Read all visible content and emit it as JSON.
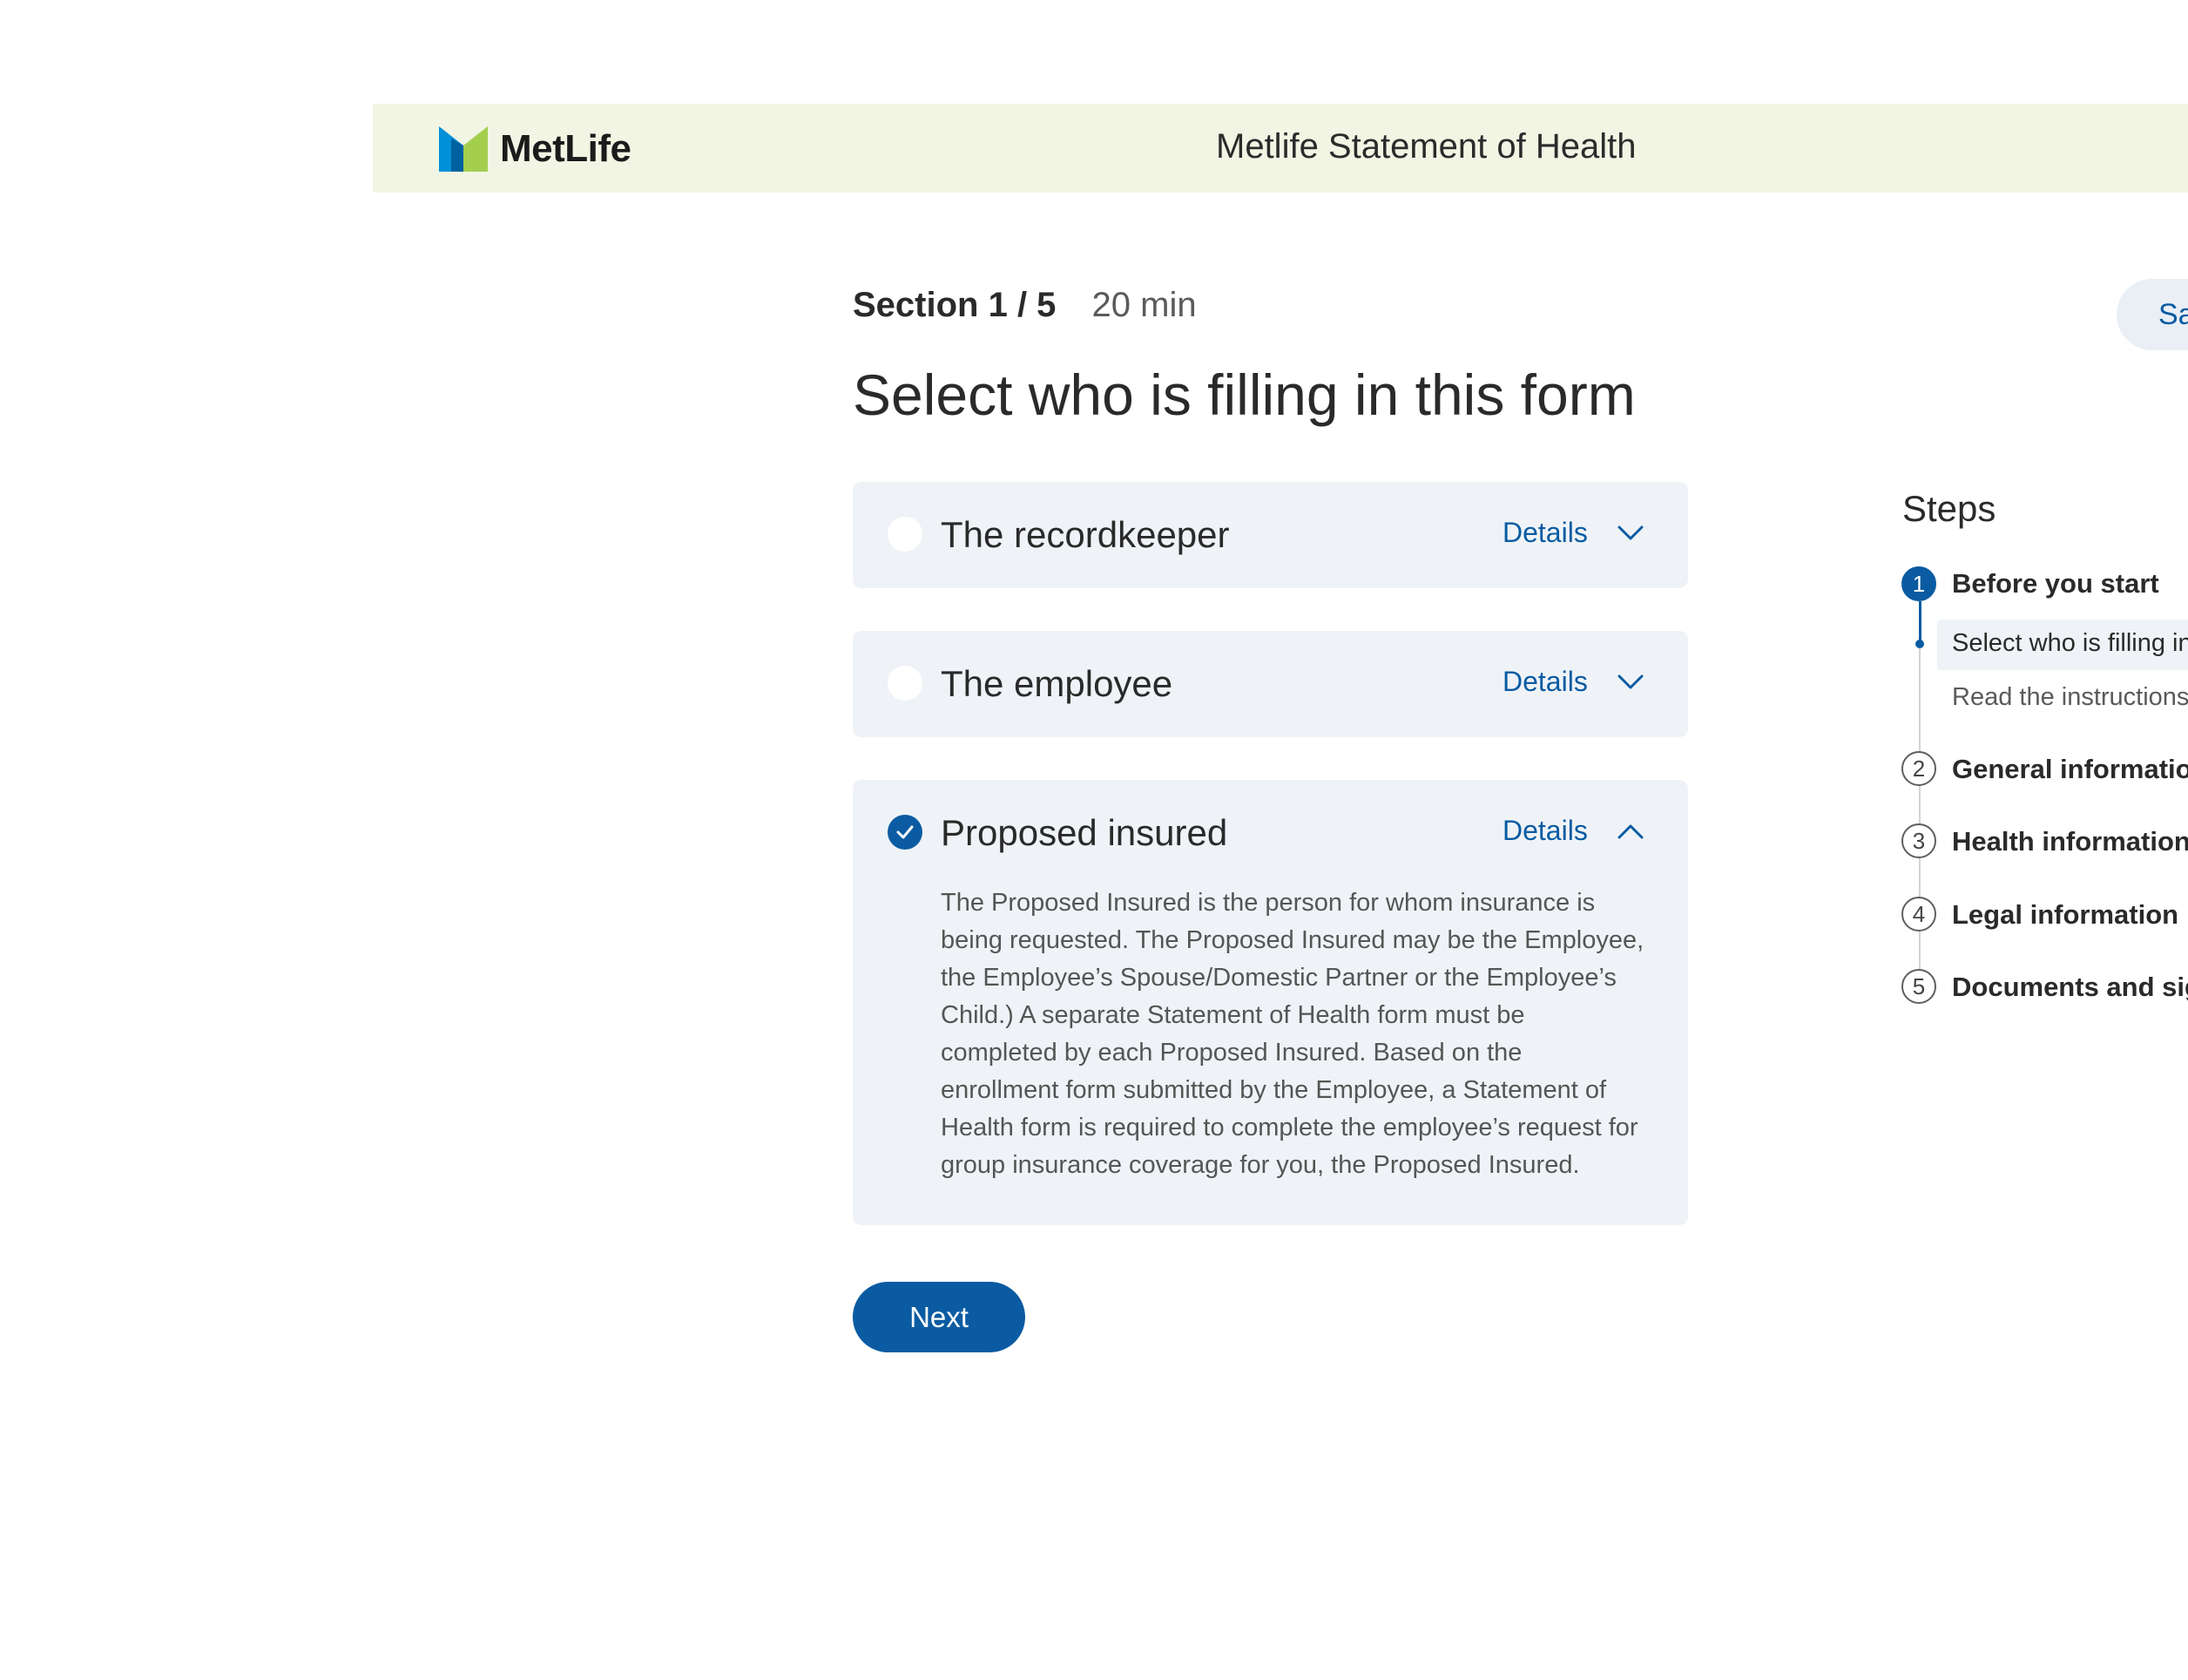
{
  "header": {
    "brand_name": "MetLife",
    "title": "Metlife Statement of Health",
    "logo_colors": [
      "#0090da",
      "#0061a0",
      "#a4ce4e"
    ]
  },
  "section": {
    "label": "Section 1 / 5",
    "duration": "20 min"
  },
  "page_title": "Select who is filling in this form",
  "options": [
    {
      "label": "The recordkeeper",
      "details_label": "Details",
      "selected": false,
      "expanded": false,
      "icon": "chevron-down-icon"
    },
    {
      "label": "The employee",
      "details_label": "Details",
      "selected": false,
      "expanded": false,
      "icon": "chevron-down-icon"
    },
    {
      "label": "Proposed insured",
      "details_label": "Details",
      "selected": true,
      "expanded": true,
      "icon": "chevron-up-icon",
      "description": "The Proposed Insured is the person for whom insurance is being requested. The Proposed Insured may be the Employee, the Employee’s Spouse/Domestic Partner or the Employee’s Child.) A separate Statement of Health form must be completed by each Proposed Insured. Based on the enrollment form submitted by the Employee, a Statement of Health form is required to complete the employee’s request for group insurance coverage for you, the Proposed Insured."
    }
  ],
  "next_label": "Next",
  "save_label": "Sa",
  "steps": {
    "title": "Steps",
    "items": [
      {
        "number": "1",
        "label": "Before you start",
        "active": true
      },
      {
        "number": "2",
        "label": "General informatio",
        "active": false
      },
      {
        "number": "3",
        "label": "Health information",
        "active": false
      },
      {
        "number": "4",
        "label": "Legal information",
        "active": false
      },
      {
        "number": "5",
        "label": "Documents and sig",
        "active": false
      }
    ],
    "substeps": [
      {
        "label": "Select who is filling in",
        "current": true
      },
      {
        "label": "Read the instructions",
        "current": false
      }
    ]
  },
  "colors": {
    "accent": "#0a5ba2",
    "header_background": "#f2f5e3",
    "card_background": "#eff3f7"
  }
}
